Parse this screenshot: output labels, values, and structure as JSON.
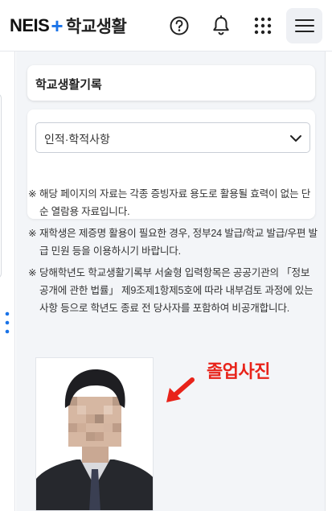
{
  "header": {
    "logo_neis": "NEIS",
    "logo_plus": "+",
    "logo_service": "학교생활",
    "icons": [
      "help-icon",
      "bell-icon",
      "apps-grid-icon",
      "hamburger-menu-icon"
    ]
  },
  "main": {
    "section_title": "학교생활기록",
    "select": {
      "value": "인적·학적사항"
    },
    "notes": [
      {
        "mark": "※",
        "text": "해당 페이지의 자료는 각종 증빙자료 용도로 활용될 효력이 없는 단순 열람용 자료입니다."
      },
      {
        "mark": "※",
        "text": "재학생은 제증명 활용이 필요한 경우, 정부24 발급/학교 발급/우편 발급 민원 등을 이용하시기 바랍니다."
      },
      {
        "mark": "※",
        "text": "당해학년도 학교생활기록부 서술형 입력항목은 공공기관의 「정보공개에 관한 법률」 제9조제1항제5호에 따라 내부검토 과정에 있는 사항 등으로 학년도 종료 전 당사자를 포함하여 비공개합니다."
      }
    ],
    "photo_annotation": "졸업사진"
  },
  "colors": {
    "accent_blue": "#1a73e8",
    "annotation_red": "#e8231a",
    "panel_bg": "#f3f5f8"
  }
}
